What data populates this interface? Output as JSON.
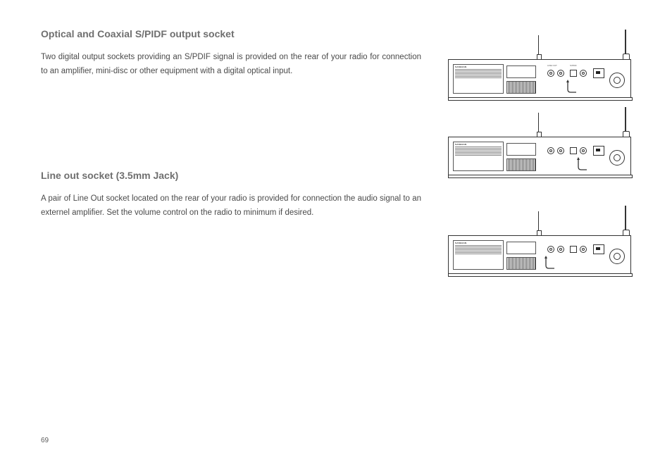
{
  "section1": {
    "title": "Optical and Coaxial S/PIDF output socket",
    "body": "Two digital output sockets providing an S/PDIF signal is provided on the rear of your radio for connection to an amplifier, mini-disc or other equipment with a digital optical input."
  },
  "section2": {
    "title": "Line out socket (3.5mm Jack)",
    "body": "A pair of Line Out socket located on the rear of your radio is provided for connection the audio signal to an externel amplifier. Set the volume control on the radio to minimum if desired."
  },
  "pageNumber": "69",
  "panelLabels": {
    "brand": "SANGEAN",
    "model": "WFT-1D"
  }
}
